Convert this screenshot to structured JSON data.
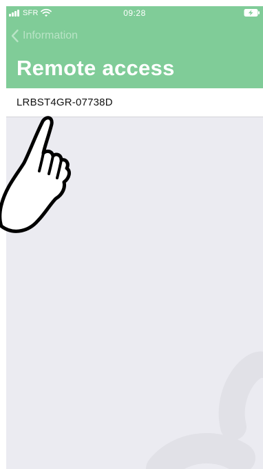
{
  "status_bar": {
    "carrier": "SFR",
    "time": "09:28",
    "signal_icon": "signal-bars-icon",
    "wifi_icon": "wifi-icon",
    "battery_icon": "battery-charging-icon"
  },
  "nav": {
    "back_label": "Information",
    "back_icon": "chevron-left-icon",
    "title": "Remote access"
  },
  "list": {
    "items": [
      {
        "label": "LRBST4GR-07738D"
      }
    ]
  },
  "overlay": {
    "pointer_icon": "pointing-hand-icon"
  },
  "colors": {
    "header_green": "#80cc98",
    "back_text": "#b9e4c6",
    "background": "#ebebf1",
    "cell_background": "#ffffff"
  }
}
